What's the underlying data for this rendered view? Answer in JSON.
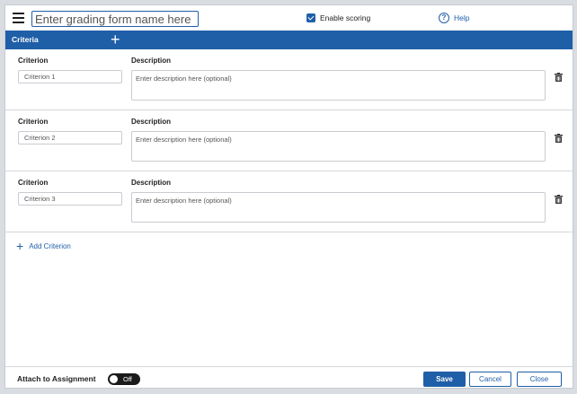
{
  "header": {
    "name_placeholder": "Enter grading form name here",
    "enable_scoring_label": "Enable scoring",
    "enable_scoring_checked": true,
    "help_label": "Help"
  },
  "criteria_bar": {
    "title": "Criteria",
    "add_icon": "plus-icon"
  },
  "rows": [
    {
      "criterion_label": "Criterion",
      "description_label": "Description",
      "criterion_placeholder": "Criterion 1",
      "description_placeholder": "Enter description here (optional)"
    },
    {
      "criterion_label": "Criterion",
      "description_label": "Description",
      "criterion_placeholder": "Criterion 2",
      "description_placeholder": "Enter description here (optional)"
    },
    {
      "criterion_label": "Criterion",
      "description_label": "Description",
      "criterion_placeholder": "Criterion 3",
      "description_placeholder": "Enter description here (optional)"
    }
  ],
  "add_criterion_label": "Add Criterion",
  "footer": {
    "attach_label": "Attach to Assignment",
    "toggle_text": "Off",
    "toggle_on": false,
    "save_label": "Save",
    "cancel_label": "Cancel",
    "close_label": "Close"
  },
  "colors": {
    "accent": "#1f5fa8",
    "toggle_off": "#1b1b1b"
  }
}
